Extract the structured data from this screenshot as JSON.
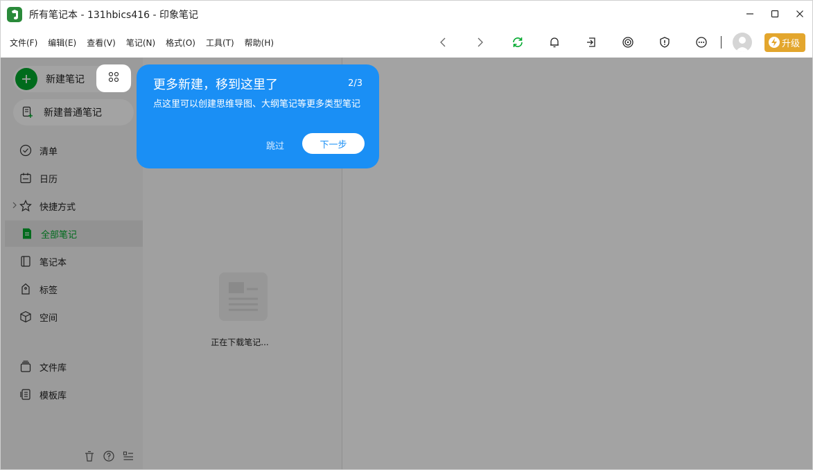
{
  "window": {
    "title": "所有笔记本 - 131hbics416 - 印象笔记",
    "controls": [
      "minimize",
      "maximize",
      "close"
    ]
  },
  "menu": [
    "文件(F)",
    "编辑(E)",
    "查看(V)",
    "笔记(N)",
    "格式(O)",
    "工具(T)",
    "帮助(H)"
  ],
  "toolbar": {
    "icons": [
      "back-arrow-icon",
      "forward-arrow-icon",
      "sync-icon",
      "bell-icon",
      "share-icon",
      "target-icon",
      "shield-icon",
      "more-icon"
    ],
    "upgrade_label": "升级",
    "accent": "#00a82d",
    "upgrade_color": "#e3a62d"
  },
  "sidebar": {
    "new_note_label": "新建笔记",
    "new_plain_label": "新建普通笔记",
    "items": [
      {
        "label": "清单",
        "icon": "check-circle-icon"
      },
      {
        "label": "日历",
        "icon": "calendar-icon"
      },
      {
        "label": "快捷方式",
        "icon": "star-icon"
      },
      {
        "label": "全部笔记",
        "icon": "note-icon"
      },
      {
        "label": "笔记本",
        "icon": "notebook-icon"
      },
      {
        "label": "标签",
        "icon": "tag-icon"
      },
      {
        "label": "空间",
        "icon": "cube-icon"
      }
    ],
    "bottom_items": [
      {
        "label": "文件库",
        "icon": "file-library-icon"
      },
      {
        "label": "模板库",
        "icon": "template-icon"
      }
    ]
  },
  "notelist": {
    "loading_text": "正在下载笔记..."
  },
  "tip": {
    "title": "更多新建，移到这里了",
    "step": "2/3",
    "body": "点这里可以创建思维导图、大纲笔记等更多类型笔记",
    "skip_label": "跳过",
    "next_label": "下一步",
    "color": "#1a8ff5"
  }
}
